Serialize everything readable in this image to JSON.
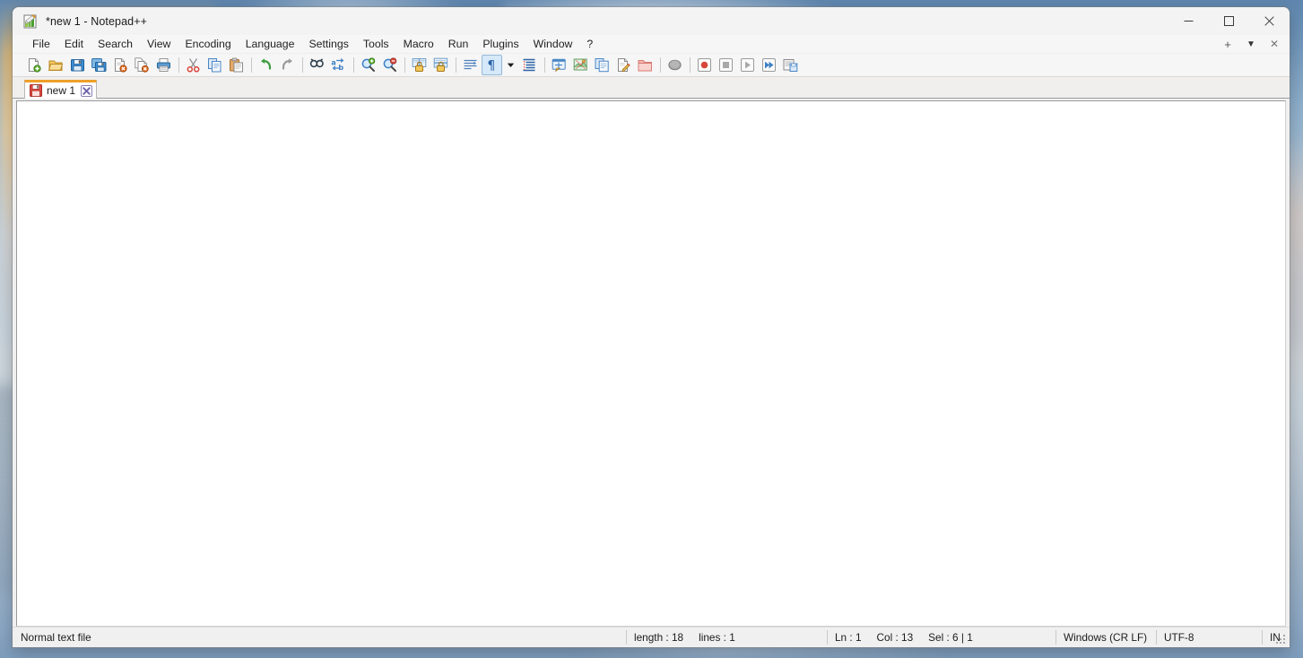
{
  "window": {
    "title": "*new 1 - Notepad++",
    "app_icon": "notepad-plus-plus-icon",
    "controls": {
      "minimize": "minimize-icon",
      "maximize": "maximize-icon",
      "close": "close-icon"
    }
  },
  "menubar": {
    "items": [
      {
        "label": "File"
      },
      {
        "label": "Edit"
      },
      {
        "label": "Search"
      },
      {
        "label": "View"
      },
      {
        "label": "Encoding"
      },
      {
        "label": "Language"
      },
      {
        "label": "Settings"
      },
      {
        "label": "Tools"
      },
      {
        "label": "Macro"
      },
      {
        "label": "Run"
      },
      {
        "label": "Plugins"
      },
      {
        "label": "Window"
      },
      {
        "label": "?"
      }
    ],
    "doc_controls": {
      "new_tab": "+",
      "tab_list": "▼",
      "close_doc": "✕"
    }
  },
  "toolbar": {
    "buttons": [
      {
        "name": "new-file-button",
        "tip": "New"
      },
      {
        "name": "open-file-button",
        "tip": "Open"
      },
      {
        "name": "save-button",
        "tip": "Save"
      },
      {
        "name": "save-all-button",
        "tip": "Save All"
      },
      {
        "name": "close-button",
        "tip": "Close"
      },
      {
        "name": "close-all-button",
        "tip": "Close All"
      },
      {
        "name": "print-button",
        "tip": "Print"
      },
      {
        "name": "cut-button",
        "tip": "Cut"
      },
      {
        "name": "copy-button",
        "tip": "Copy"
      },
      {
        "name": "paste-button",
        "tip": "Paste"
      },
      {
        "name": "undo-button",
        "tip": "Undo"
      },
      {
        "name": "redo-button",
        "tip": "Redo"
      },
      {
        "name": "find-button",
        "tip": "Find"
      },
      {
        "name": "replace-button",
        "tip": "Replace"
      },
      {
        "name": "zoom-in-button",
        "tip": "Zoom In"
      },
      {
        "name": "zoom-out-button",
        "tip": "Zoom Out"
      },
      {
        "name": "sync-vertical-scroll-button",
        "tip": "Synchronize Vertical Scrolling"
      },
      {
        "name": "sync-horizontal-scroll-button",
        "tip": "Synchronize Horizontal Scrolling"
      },
      {
        "name": "word-wrap-button",
        "tip": "Word wrap"
      },
      {
        "name": "show-all-characters-button",
        "tip": "Show All Characters",
        "active": true
      },
      {
        "name": "show-all-characters-dropdown",
        "tip": "Show All Characters options"
      },
      {
        "name": "indent-guide-button",
        "tip": "Show Indent Guide"
      },
      {
        "name": "user-defined-dialog-button",
        "tip": "User Defined Dialogue"
      },
      {
        "name": "document-map-button",
        "tip": "Document Map"
      },
      {
        "name": "function-list-button",
        "tip": "Function List"
      },
      {
        "name": "document-switcher-button",
        "tip": "Document List"
      },
      {
        "name": "folder-as-workspace-button",
        "tip": "Folder as Workspace"
      },
      {
        "name": "monitoring-button",
        "tip": "Monitoring"
      },
      {
        "name": "macro-record-button",
        "tip": "Start Recording"
      },
      {
        "name": "macro-stop-button",
        "tip": "Stop Recording"
      },
      {
        "name": "macro-play-button",
        "tip": "Playback"
      },
      {
        "name": "macro-run-multiple-button",
        "tip": "Run a Macro Multiple Times"
      },
      {
        "name": "macro-save-button",
        "tip": "Save Current Recorded Macro"
      }
    ]
  },
  "tabs": [
    {
      "label": "new 1",
      "icon": "unsaved-floppy-icon",
      "close_icon": "tab-close-icon",
      "active": true,
      "modified": true
    }
  ],
  "editor": {
    "content": "",
    "placeholder": ""
  },
  "statusbar": {
    "file_type": "Normal text file",
    "length_label": "length : 18",
    "lines_label": "lines : 1",
    "ln_label": "Ln : 1",
    "col_label": "Col : 13",
    "sel_label": "Sel : 6 | 1",
    "eol": "Windows (CR LF)",
    "encoding": "UTF-8",
    "insert_mode": "IN"
  },
  "colors": {
    "tab_active_accent": "#ef9f29",
    "toolbar_active_bg": "#d6e9fa",
    "window_bg": "#f0f0f0",
    "editor_bg": "#ffffff"
  }
}
